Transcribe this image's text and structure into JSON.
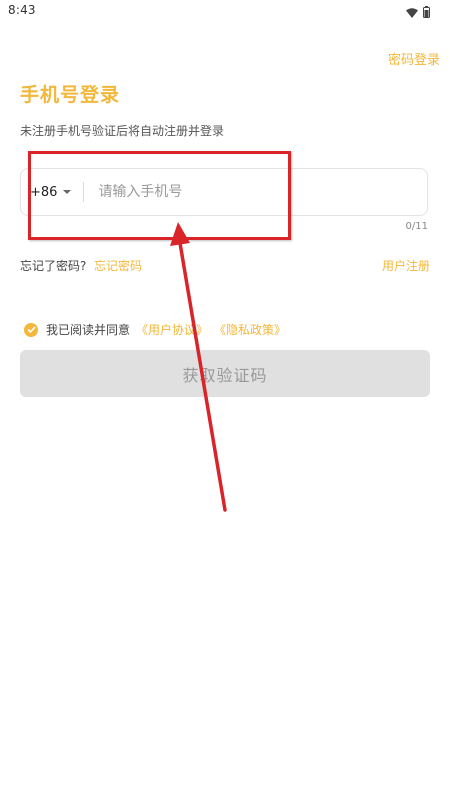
{
  "status_bar": {
    "time": "8:43"
  },
  "header": {
    "password_login_label": "密码登录"
  },
  "page": {
    "title": "手机号登录",
    "subtitle": "未注册手机号验证后将自动注册并登录"
  },
  "phone_field": {
    "country_code": "+86",
    "placeholder": "请输入手机号",
    "value": "",
    "counter": "0/11"
  },
  "links": {
    "forgot_prompt": "忘记了密码?",
    "forgot_link": "忘记密码",
    "register_link": "用户注册"
  },
  "agreement": {
    "checked": true,
    "prefix": "我已阅读并同意",
    "user_agreement": "《用户协议》",
    "privacy_policy": "《隐私政策》"
  },
  "actions": {
    "get_code_label": "获取验证码"
  },
  "colors": {
    "accent": "#f3b73a",
    "disabled_button": "#e0e0e0",
    "annotation": "#d9252a"
  },
  "icons": [
    "wifi-icon",
    "battery-icon",
    "chevron-down-icon",
    "check-circle-icon"
  ]
}
